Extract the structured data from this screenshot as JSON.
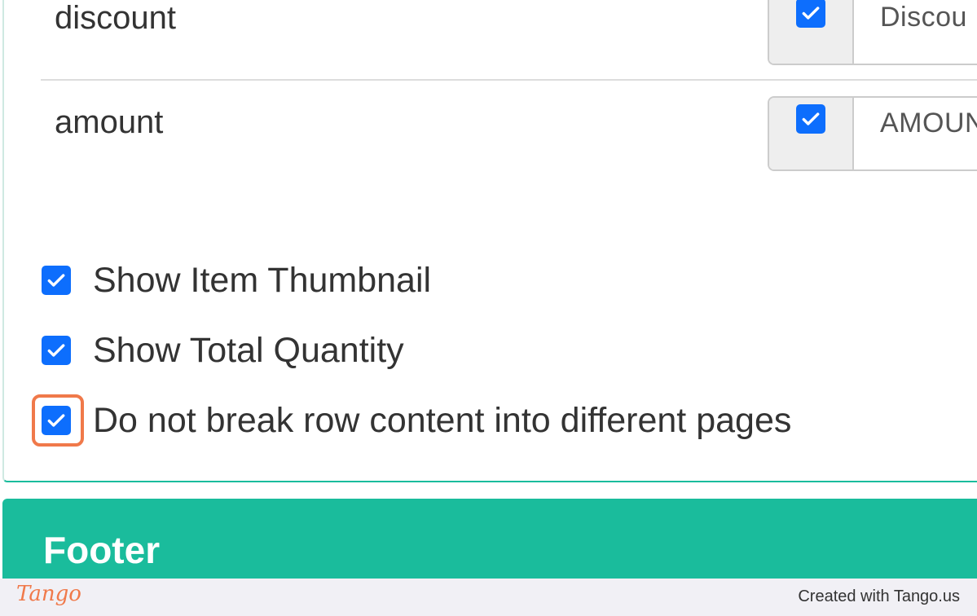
{
  "rows": [
    {
      "label": "discount",
      "checked": true,
      "value": "Discou"
    },
    {
      "label": "amount",
      "checked": true,
      "value": "AMOUN"
    }
  ],
  "options": [
    {
      "label": "Show Item Thumbnail",
      "checked": true
    },
    {
      "label": "Show Total Quantity",
      "checked": true
    },
    {
      "label": "Do not break row content into different pages",
      "checked": true,
      "highlighted": true
    }
  ],
  "footer": {
    "title": "Footer"
  },
  "tango": {
    "logo": "Tango",
    "credit": "Created with Tango.us"
  },
  "colors": {
    "accent": "#1abc9c",
    "checkbox": "#0d6efd",
    "highlight": "#f0794a"
  },
  "icons": {
    "checkbox": "checkmark-icon"
  }
}
